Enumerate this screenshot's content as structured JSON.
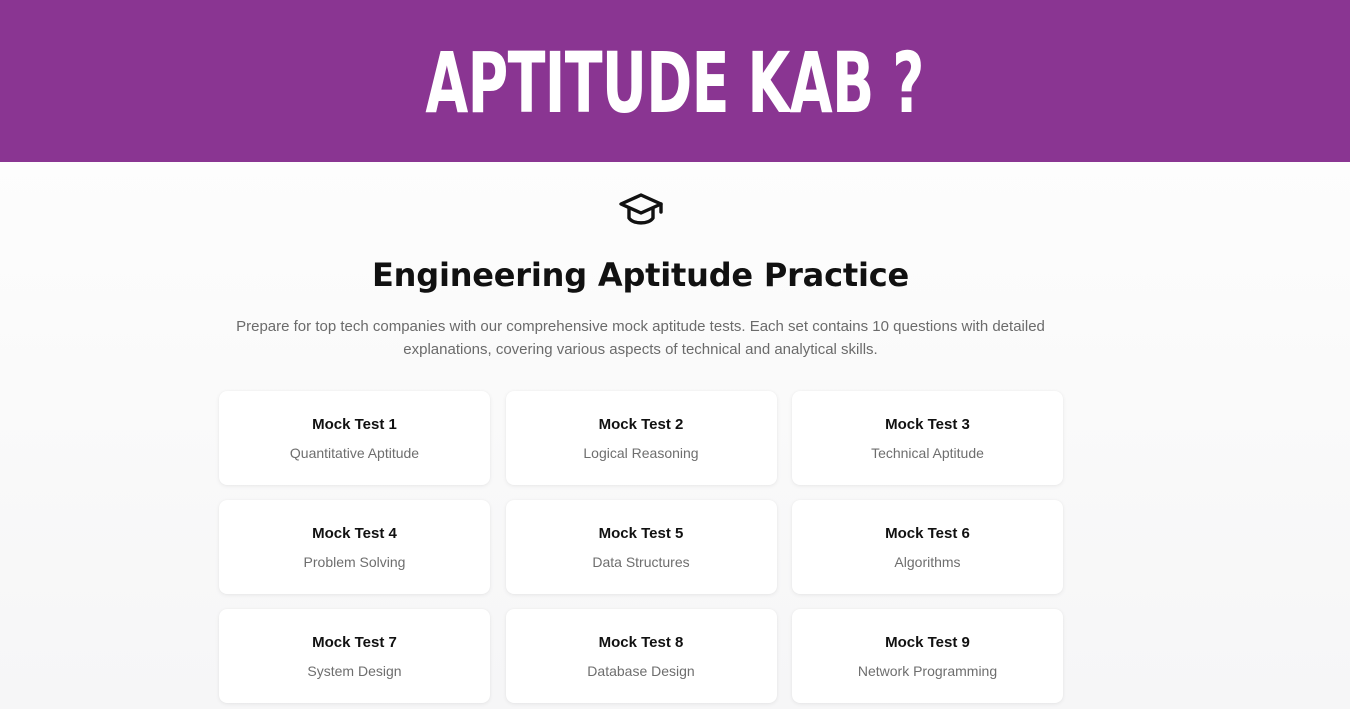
{
  "banner": {
    "title": "APTITUDE KAB ?"
  },
  "header": {
    "icon": "graduation-cap-icon",
    "title": "Engineering Aptitude Practice",
    "description": "Prepare for top tech companies with our comprehensive mock aptitude tests. Each set contains 10 questions with detailed explanations, covering various aspects of technical and analytical skills."
  },
  "tests": [
    {
      "title": "Mock Test 1",
      "subtitle": "Quantitative Aptitude"
    },
    {
      "title": "Mock Test 2",
      "subtitle": "Logical Reasoning"
    },
    {
      "title": "Mock Test 3",
      "subtitle": "Technical Aptitude"
    },
    {
      "title": "Mock Test 4",
      "subtitle": "Problem Solving"
    },
    {
      "title": "Mock Test 5",
      "subtitle": "Data Structures"
    },
    {
      "title": "Mock Test 6",
      "subtitle": "Algorithms"
    },
    {
      "title": "Mock Test 7",
      "subtitle": "System Design"
    },
    {
      "title": "Mock Test 8",
      "subtitle": "Database Design"
    },
    {
      "title": "Mock Test 9",
      "subtitle": "Network Programming"
    }
  ],
  "colors": {
    "banner_background": "#8a3592",
    "banner_text": "#ffffff",
    "title_text": "#111111",
    "muted_text": "#6b6b6b",
    "card_background": "#ffffff"
  }
}
